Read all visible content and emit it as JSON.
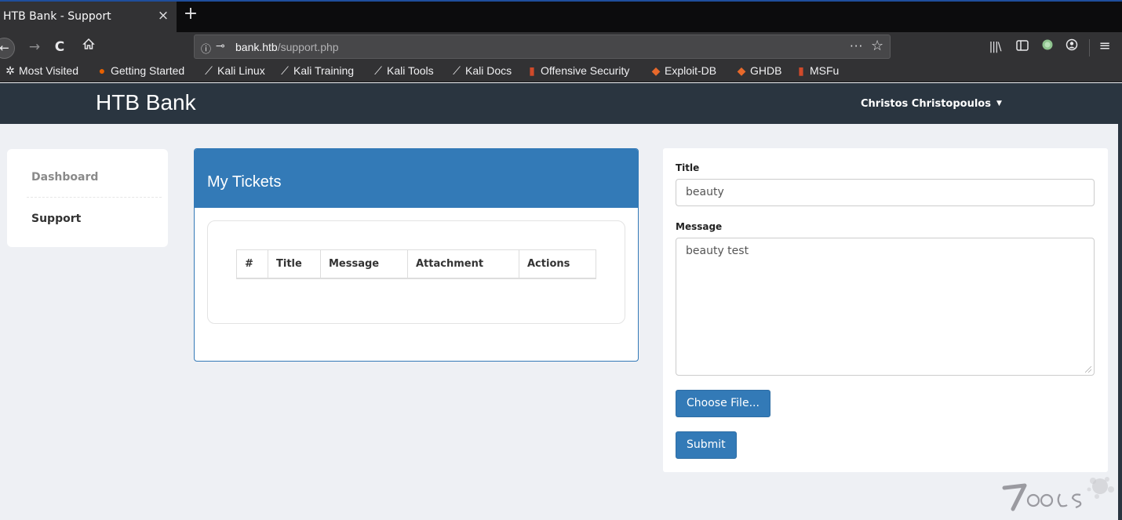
{
  "browser": {
    "tab_title": "HTB Bank - Support",
    "tab_close": "×",
    "new_tab": "+",
    "url_host": "bank.htb",
    "url_path": "/support.php",
    "url_more": "···",
    "bookmarks": [
      {
        "label": "Most Visited",
        "icon": "gear-icon"
      },
      {
        "label": "Getting Started",
        "icon": "firefox-icon"
      },
      {
        "label": "Kali Linux",
        "icon": "kali-dragon-icon"
      },
      {
        "label": "Kali Training",
        "icon": "kali-dragon-icon"
      },
      {
        "label": "Kali Tools",
        "icon": "kali-dragon-icon"
      },
      {
        "label": "Kali Docs",
        "icon": "kali-dragon-icon"
      },
      {
        "label": "Offensive Security",
        "icon": "offsec-icon"
      },
      {
        "label": "Exploit-DB",
        "icon": "exploitdb-icon"
      },
      {
        "label": "GHDB",
        "icon": "exploitdb-icon"
      },
      {
        "label": "MSFu",
        "icon": "offsec-icon"
      }
    ]
  },
  "site": {
    "brand": "HTB Bank",
    "user_name": "Christos Christopoulos",
    "header_color": "#2a3540",
    "accent": "#337ab7"
  },
  "sidebar": {
    "items": [
      {
        "label": "Dashboard"
      },
      {
        "label": "Support"
      }
    ]
  },
  "tickets": {
    "title": "My Tickets",
    "columns": [
      "#",
      "Title",
      "Message",
      "Attachment",
      "Actions"
    ]
  },
  "form": {
    "title_label": "Title",
    "title_value": "beauty",
    "message_label": "Message",
    "message_value": "beauty test",
    "choose_file_label": "Choose File...",
    "submit_label": "Submit"
  },
  "watermark": {
    "text": "7OOLS"
  }
}
